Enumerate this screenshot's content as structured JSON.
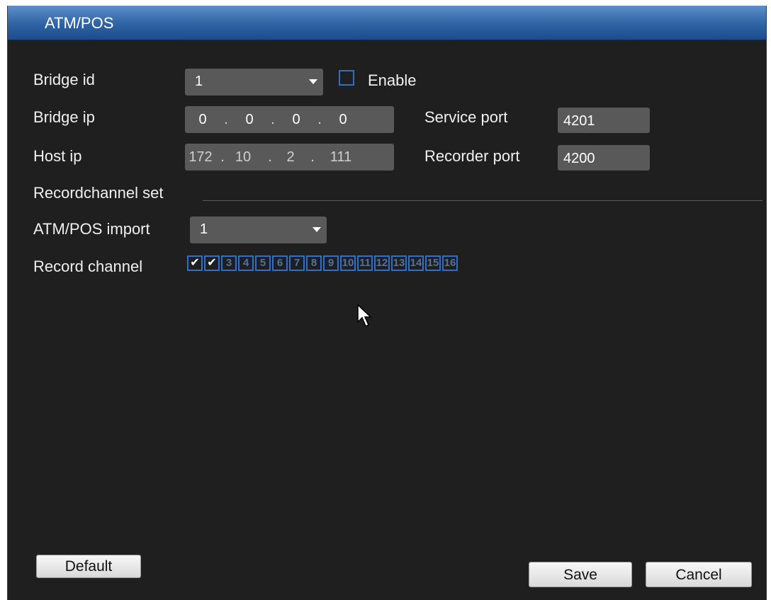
{
  "window": {
    "title": "ATM/POS"
  },
  "form": {
    "bridge_id": {
      "label": "Bridge id",
      "value": "1"
    },
    "enable": {
      "label": "Enable",
      "checked": false
    },
    "bridge_ip": {
      "label": "Bridge ip",
      "octets": [
        "0",
        "0",
        "0",
        "0"
      ],
      "separator": "."
    },
    "service_port": {
      "label": "Service port",
      "value": "4201"
    },
    "host_ip": {
      "label": "Host ip",
      "octets": [
        "172",
        "10",
        "2",
        "111"
      ],
      "separator": "."
    },
    "recorder_port": {
      "label": "Recorder port",
      "value": "4200"
    },
    "section_label": "Recordchannel set",
    "atm_pos_import": {
      "label": "ATM/POS import",
      "value": "1"
    },
    "record_channel": {
      "label": "Record channel",
      "checkmark": "✔",
      "channels": [
        {
          "num": "1",
          "checked": true
        },
        {
          "num": "2",
          "checked": true
        },
        {
          "num": "3",
          "checked": false
        },
        {
          "num": "4",
          "checked": false
        },
        {
          "num": "5",
          "checked": false
        },
        {
          "num": "6",
          "checked": false
        },
        {
          "num": "7",
          "checked": false
        },
        {
          "num": "8",
          "checked": false
        },
        {
          "num": "9",
          "checked": false
        },
        {
          "num": "10",
          "checked": false
        },
        {
          "num": "11",
          "checked": false
        },
        {
          "num": "12",
          "checked": false
        },
        {
          "num": "13",
          "checked": false
        },
        {
          "num": "14",
          "checked": false
        },
        {
          "num": "15",
          "checked": false
        },
        {
          "num": "16",
          "checked": false
        }
      ]
    }
  },
  "buttons": {
    "default": "Default",
    "save": "Save",
    "cancel": "Cancel"
  },
  "colors": {
    "accent": "#2f6fc9",
    "titlebar": "#2f62a3",
    "panel": "#1f1f1f",
    "field": "#595959"
  }
}
